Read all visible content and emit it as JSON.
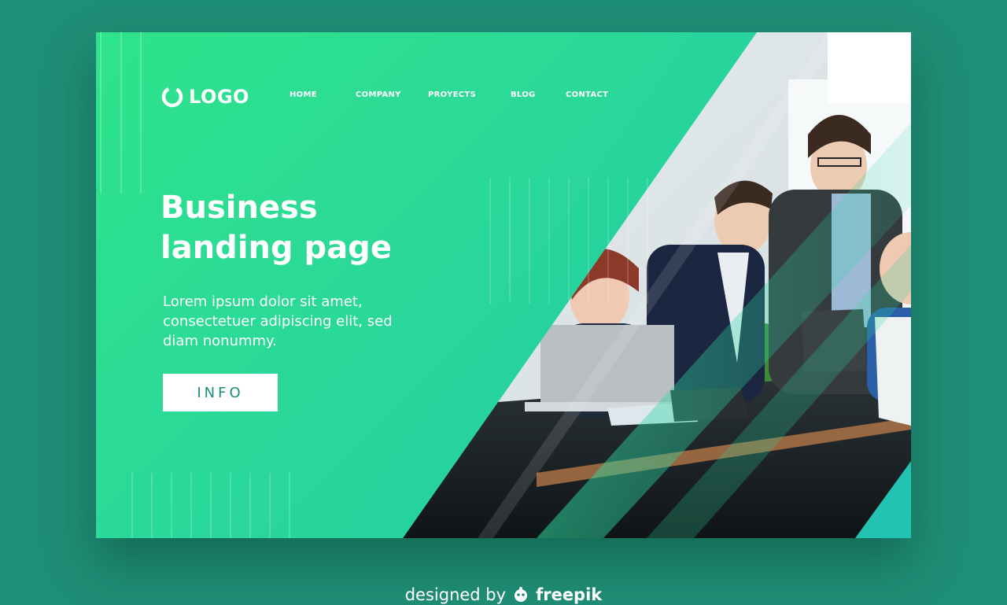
{
  "nav": {
    "logo_text": "LOGO",
    "items": [
      "HOME",
      "COMPANY",
      "PROYECTS",
      "BLOG",
      "CONTACT"
    ]
  },
  "hero": {
    "title_line1": "Business",
    "title_line2": "landing page",
    "desc_line1": "Lorem ipsum dolor sit amet,",
    "desc_line2": "consectetuer adipiscing elit, sed",
    "desc_line3": "diam nonummy.",
    "button_label": "INFO"
  },
  "credit": {
    "prefix": "designed by",
    "brand": "freepik"
  },
  "colors": {
    "background": "#1f8e76",
    "gradient_start": "#2ee48a",
    "gradient_end": "#23c7a6",
    "button_text": "#1c8e77"
  },
  "icons": {
    "logo": "ring-logo-icon",
    "credit": "freepik-logo-icon"
  }
}
